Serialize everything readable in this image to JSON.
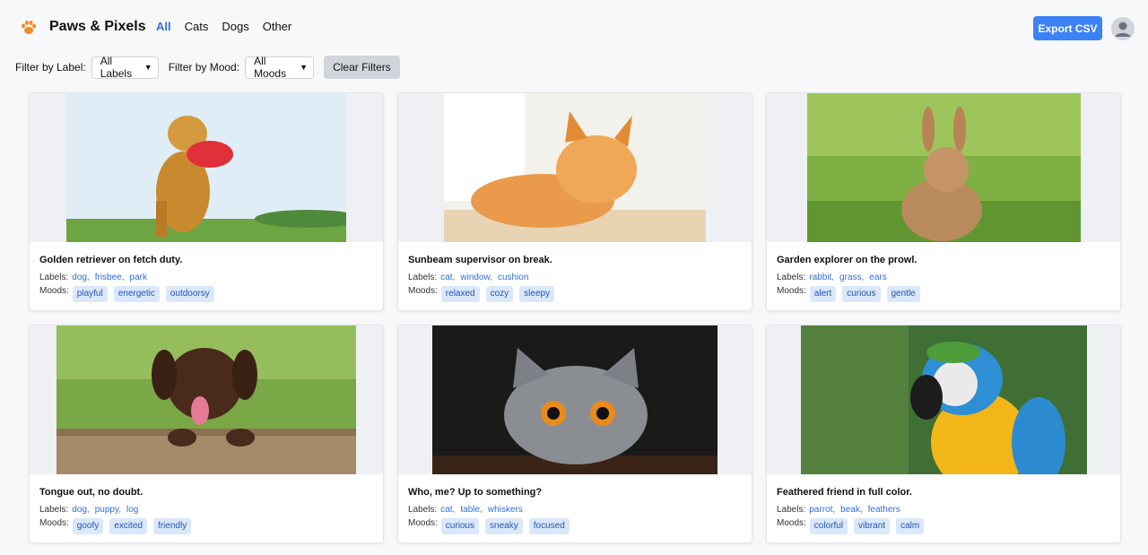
{
  "app": {
    "brand": "Paws & Pixels",
    "nav": [
      "All",
      "Cats",
      "Dogs",
      "Other"
    ],
    "active_nav": "All",
    "export_label": "Export CSV",
    "accent_color": "#3b82f6"
  },
  "filters": {
    "label_title": "Filter by Label:",
    "label_value": "All Labels",
    "mood_title": "Filter by Mood:",
    "mood_value": "All Moods",
    "clear_label": "Clear Filters"
  },
  "common": {
    "labels_title": "Labels:",
    "moods_title": "Moods:"
  },
  "cards": [
    {
      "caption": "Golden retriever on fetch duty.",
      "labels": [
        "dog,",
        "frisbee,",
        "park"
      ],
      "moods": [
        "playful",
        "energetic",
        "outdoorsy"
      ],
      "image": "golden-retriever-frisbee"
    },
    {
      "caption": "Sunbeam supervisor on break.",
      "labels": [
        "cat,",
        "window,",
        "cushion"
      ],
      "moods": [
        "relaxed",
        "cozy",
        "sleepy"
      ],
      "image": "orange-cat-sleeping"
    },
    {
      "caption": "Garden explorer on the prowl.",
      "labels": [
        "rabbit,",
        "grass,",
        "ears"
      ],
      "moods": [
        "alert",
        "curious",
        "gentle"
      ],
      "image": "rabbit-in-grass"
    },
    {
      "caption": "Tongue out, no doubt.",
      "labels": [
        "dog,",
        "puppy,",
        "log"
      ],
      "moods": [
        "goofy",
        "excited",
        "friendly"
      ],
      "image": "chocolate-lab-puppy"
    },
    {
      "caption": "Who, me? Up to something?",
      "labels": [
        "cat,",
        "table,",
        "whiskers"
      ],
      "moods": [
        "curious",
        "sneaky",
        "focused"
      ],
      "image": "grey-cat-peeking"
    },
    {
      "caption": "Feathered friend in full color.",
      "labels": [
        "parrot,",
        "beak,",
        "feathers"
      ],
      "moods": [
        "colorful",
        "vibrant",
        "calm"
      ],
      "image": "blue-yellow-macaw"
    }
  ]
}
